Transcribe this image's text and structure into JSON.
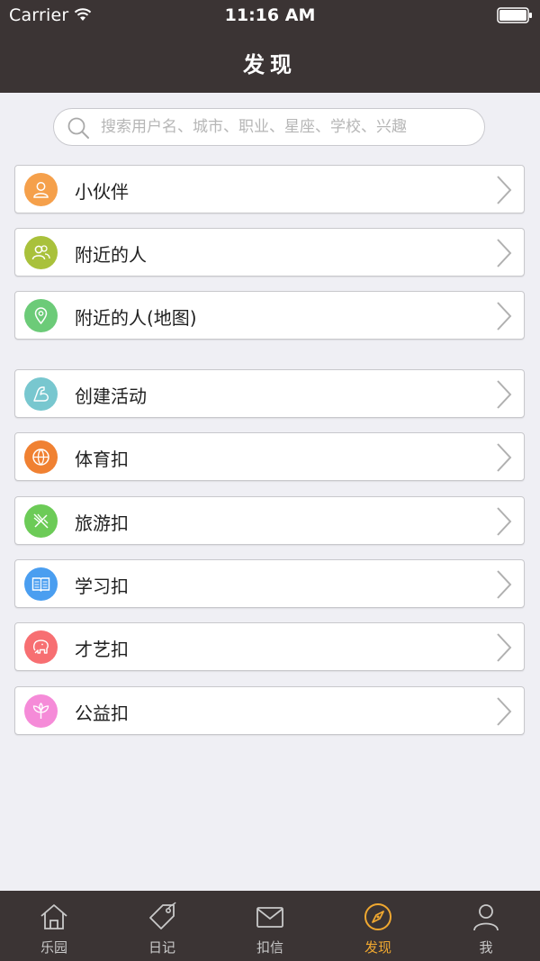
{
  "status_bar": {
    "carrier": "Carrier",
    "time": "11:16 AM"
  },
  "header": {
    "title": "发现"
  },
  "search": {
    "placeholder": "搜索用户名、城市、职业、星座、学校、兴趣"
  },
  "menu": {
    "items": [
      {
        "label": "小伙伴",
        "icon": "person-icon",
        "color": "#f5a04b"
      },
      {
        "label": "附近的人",
        "icon": "people-icon",
        "color": "#a9c13b"
      },
      {
        "label": "附近的人(地图)",
        "icon": "map-pin-icon",
        "color": "#6ccb78"
      },
      {
        "label": "创建活动",
        "icon": "arm-icon",
        "color": "#78c7cf"
      },
      {
        "label": "体育扣",
        "icon": "basketball-icon",
        "color": "#f08132"
      },
      {
        "label": "旅游扣",
        "icon": "airplane-icon",
        "color": "#6ccb57"
      },
      {
        "label": "学习扣",
        "icon": "book-icon",
        "color": "#4a9ef0"
      },
      {
        "label": "才艺扣",
        "icon": "elephant-icon",
        "color": "#f76f72"
      },
      {
        "label": "公益扣",
        "icon": "leaves-icon",
        "color": "#f58bd8"
      }
    ]
  },
  "tab_bar": {
    "active_color": "#f0a830",
    "items": [
      {
        "label": "乐园",
        "icon": "home-icon"
      },
      {
        "label": "日记",
        "icon": "tag-icon"
      },
      {
        "label": "扣信",
        "icon": "envelope-icon"
      },
      {
        "label": "发现",
        "icon": "compass-icon"
      },
      {
        "label": "我",
        "icon": "user-icon"
      }
    ]
  }
}
